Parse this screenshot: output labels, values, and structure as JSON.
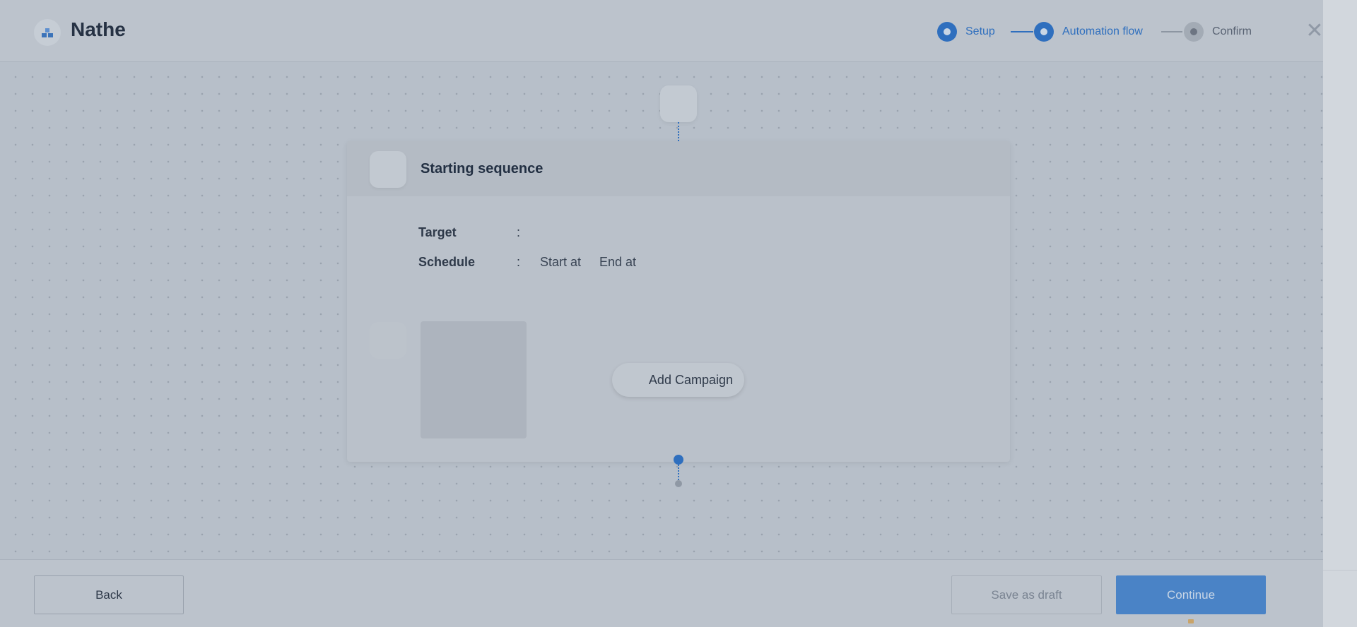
{
  "header": {
    "title": "Nathe",
    "steps": [
      {
        "label": "Setup",
        "state": "active"
      },
      {
        "label": "Automation flow",
        "state": "active"
      },
      {
        "label": "Confirm",
        "state": "idle"
      }
    ],
    "close_icon": "close-icon"
  },
  "flow": {
    "card_title": "Starting sequence",
    "target_label": "Target",
    "schedule_label": "Schedule",
    "separator": ":",
    "start_at_label": "Start at",
    "end_at_label": "End at",
    "add_campaign_label": "Add Campaign"
  },
  "footer": {
    "back_label": "Back",
    "save_draft_label": "Save as draft",
    "continue_label": "Continue"
  },
  "colors": {
    "accent": "#2f6fbe",
    "overlay_bg": "#b7bfc9",
    "continue_bg": "#4a83c6"
  }
}
